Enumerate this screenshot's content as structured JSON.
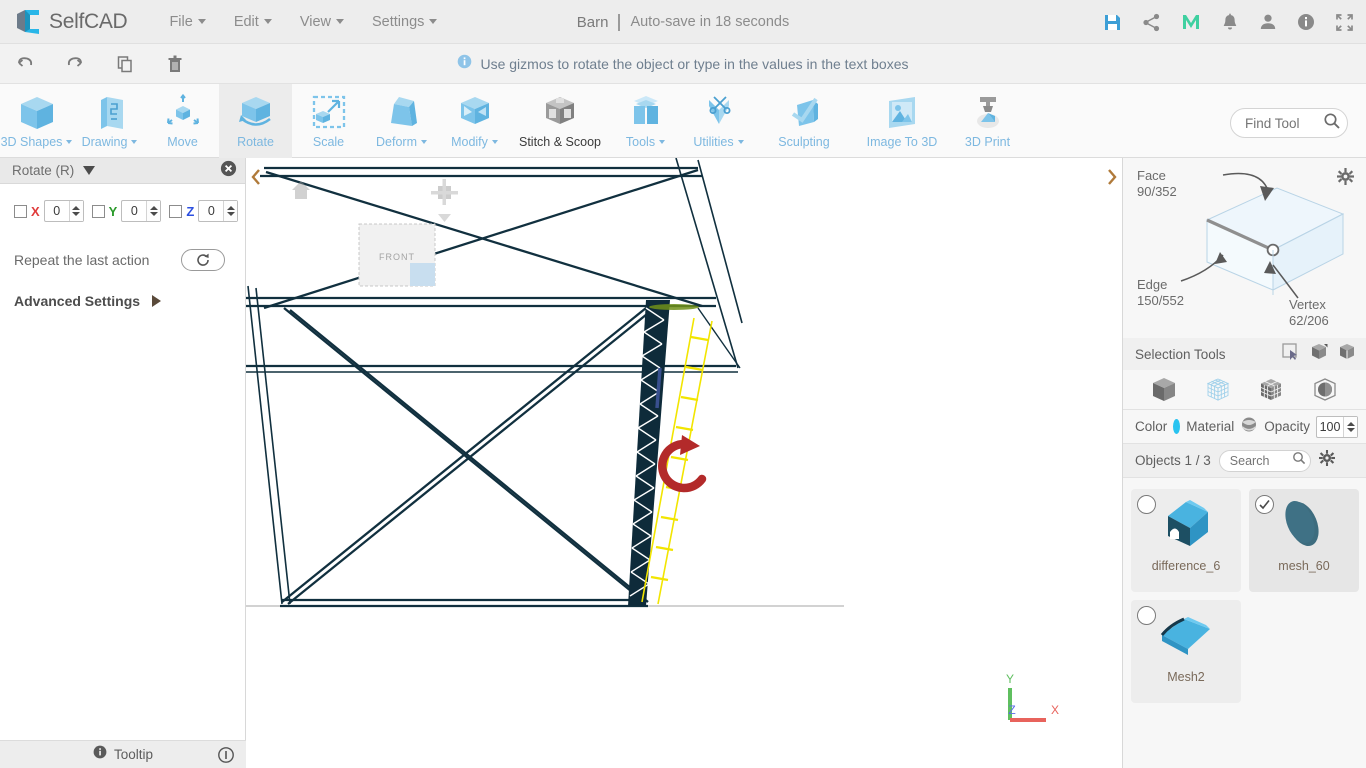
{
  "app": {
    "brand": "SelfCAD",
    "brand_logo_icon": "selfcad-logo-icon"
  },
  "menubar": {
    "items": [
      {
        "label": "File",
        "icon": "caret-down-icon"
      },
      {
        "label": "Edit",
        "icon": "caret-down-icon"
      },
      {
        "label": "View",
        "icon": "caret-down-icon"
      },
      {
        "label": "Settings",
        "icon": "caret-down-icon"
      }
    ],
    "document_name": "Barn",
    "autosave_text": "Auto-save in 18 seconds",
    "right_icons": [
      {
        "name": "save-icon",
        "color": "#3d9fd6"
      },
      {
        "name": "share-icon",
        "color": "#8a8a8a"
      },
      {
        "name": "mymagic-m-icon",
        "color": "#3fd0a0"
      },
      {
        "name": "notifications-bell-icon",
        "color": "#8a8a8a"
      },
      {
        "name": "user-account-icon",
        "color": "#8a8a8a"
      },
      {
        "name": "info-icon",
        "color": "#8a8a8a"
      },
      {
        "name": "fullscreen-icon",
        "color": "#8a8a8a"
      }
    ]
  },
  "subtoolbar": {
    "buttons": [
      {
        "name": "undo-icon",
        "label": "Undo"
      },
      {
        "name": "redo-icon",
        "label": "Redo"
      },
      {
        "name": "copy-icon",
        "label": "Copy"
      },
      {
        "name": "delete-trash-icon",
        "label": "Delete"
      }
    ],
    "hint": "Use gizmos to rotate the object or type in the values in the text boxes",
    "hint_icon": "info-circle-icon"
  },
  "ribbon": {
    "tools": [
      {
        "label": "3D Shapes",
        "icon": "cube-icon",
        "dropdown": true,
        "active": false,
        "dark": false
      },
      {
        "label": "Drawing",
        "icon": "drawing-panel-icon",
        "dropdown": true,
        "active": false,
        "dark": false
      },
      {
        "label": "Move",
        "icon": "move-arrows-icon",
        "dropdown": false,
        "active": false,
        "dark": false
      },
      {
        "label": "Rotate",
        "icon": "rotate-cube-icon",
        "dropdown": false,
        "active": true,
        "dark": false
      },
      {
        "label": "Scale",
        "icon": "scale-icon",
        "dropdown": false,
        "active": false,
        "dark": false
      },
      {
        "label": "Deform",
        "icon": "deform-icon",
        "dropdown": true,
        "active": false,
        "dark": false
      },
      {
        "label": "Modify",
        "icon": "modify-icon",
        "dropdown": true,
        "active": false,
        "dark": false
      },
      {
        "label": "Stitch & Scoop",
        "icon": "stitch-scoop-icon",
        "dropdown": false,
        "active": false,
        "dark": true
      },
      {
        "label": "Tools",
        "icon": "tools-icon",
        "dropdown": true,
        "active": false,
        "dark": false
      },
      {
        "label": "Utilities",
        "icon": "utilities-scissors-icon",
        "dropdown": true,
        "active": false,
        "dark": false
      },
      {
        "label": "Sculpting",
        "icon": "sculpting-brush-icon",
        "dropdown": false,
        "active": false,
        "dark": false
      },
      {
        "label": "Image To 3D",
        "icon": "image-to-3d-icon",
        "dropdown": false,
        "active": false,
        "dark": false
      },
      {
        "label": "3D Print",
        "icon": "3d-print-icon",
        "dropdown": false,
        "active": false,
        "dark": false
      }
    ],
    "find_tool": {
      "placeholder": "Find Tool",
      "value": "",
      "icon": "search-icon"
    }
  },
  "left_panel": {
    "title": "Rotate (R)",
    "collapse_icon": "caret-down-icon",
    "close_icon": "close-circle-icon",
    "axes": [
      {
        "label": "X",
        "value": "0",
        "checked": false,
        "color": "#e03b3b"
      },
      {
        "label": "Y",
        "value": "0",
        "checked": false,
        "color": "#2a9a2a"
      },
      {
        "label": "Z",
        "value": "0",
        "checked": false,
        "color": "#2c4fe0"
      }
    ],
    "repeat_label": "Repeat the last action",
    "repeat_icon": "refresh-icon",
    "advanced_label": "Advanced Settings",
    "advanced_icon": "caret-right-icon",
    "status": {
      "label": "Tooltip",
      "icon": "info-circle-icon",
      "right_icon": "toggle-info-icon"
    }
  },
  "viewport": {
    "collapse_left_icon": "chevron-left-icon",
    "collapse_right_icon": "chevron-right-icon",
    "navcube": {
      "home_icon": "home-icon",
      "face_label": "FRONT"
    },
    "axis_indicator": {
      "x_label": "X",
      "y_label": "Y",
      "z_label": "Z",
      "x_color": "#e8635c",
      "y_color": "#5fbf5f",
      "z_color": "#5c6ce8"
    },
    "gizmo": {
      "rotate_arc_icon": "rotate-gizmo-icon",
      "arc_color": "#b32a2a"
    },
    "selection_outline_color": "#f2e500"
  },
  "right_panel": {
    "gear_icon": "gear-icon",
    "counts": [
      {
        "label": "Face",
        "value": "90/352"
      },
      {
        "label": "Edge",
        "value": "150/552"
      },
      {
        "label": "Vertex",
        "value": "62/206"
      }
    ],
    "selection_tools": {
      "label": "Selection Tools",
      "icons": [
        {
          "name": "rectangle-select-icon"
        },
        {
          "name": "select-through-icon"
        },
        {
          "name": "select-all-icon"
        }
      ]
    },
    "modes": [
      {
        "name": "object-mode-icon",
        "active": true
      },
      {
        "name": "vertex-mode-icon",
        "active": false
      },
      {
        "name": "face-mode-icon",
        "active": false
      },
      {
        "name": "edge-mode-icon",
        "active": false
      }
    ],
    "material_bar": {
      "color_label": "Color",
      "color_value": "#29c3f0",
      "material_label": "Material",
      "material_icon": "material-sphere-icon",
      "opacity_label": "Opacity",
      "opacity_value": "100"
    },
    "objects_bar": {
      "label": "Objects 1 / 3",
      "search_placeholder": "Search",
      "search_value": "",
      "search_icon": "search-icon",
      "gear_icon": "gear-icon"
    },
    "objects": [
      {
        "name": "difference_6",
        "selected": false,
        "thumb": "barn-difference-thumb"
      },
      {
        "name": "mesh_60",
        "selected": true,
        "thumb": "ellipse-mesh-thumb"
      },
      {
        "name": "Mesh2",
        "selected": false,
        "thumb": "roof-mesh-thumb"
      }
    ]
  }
}
